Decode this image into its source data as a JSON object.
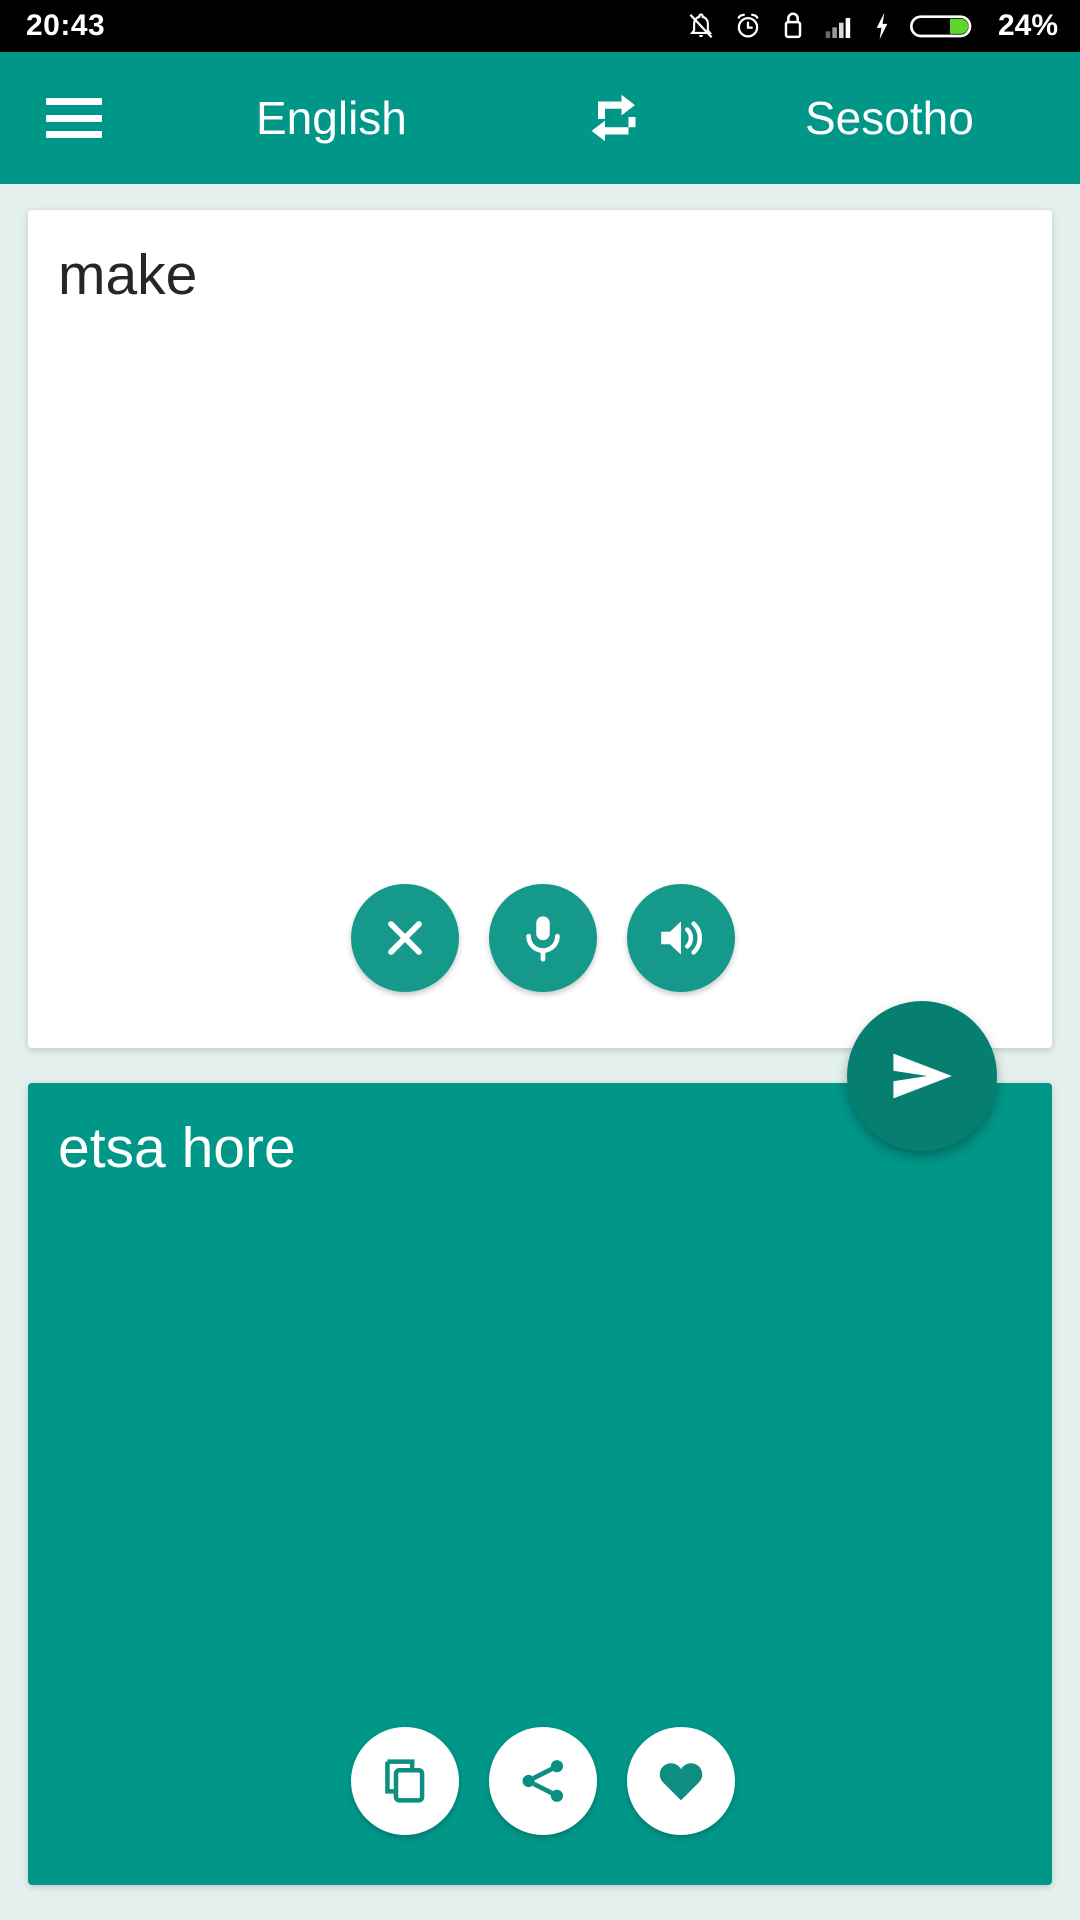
{
  "status_bar": {
    "time": "20:43",
    "battery_percent": "24%",
    "icons": [
      "bell-off-icon",
      "alarm-clock-icon",
      "usb-lock-icon",
      "signal-bars-icon",
      "charging-bolt-icon",
      "battery-icon"
    ]
  },
  "app_bar": {
    "menu_label": "menu-icon",
    "source_language": "English",
    "target_language": "Sesotho",
    "swap_label": "swap-languages-icon",
    "background_color": "#009688"
  },
  "source_card": {
    "text": "make",
    "placeholder": "",
    "actions": [
      {
        "name": "clear-button",
        "icon": "close-icon"
      },
      {
        "name": "voice-input-button",
        "icon": "microphone-icon"
      },
      {
        "name": "speak-source-button",
        "icon": "speaker-icon"
      }
    ],
    "background_color": "#ffffff",
    "button_color": "#14998a"
  },
  "send_button": {
    "name": "translate-send-button",
    "icon": "send-icon",
    "color": "#067f71"
  },
  "target_card": {
    "text": "etsa hore",
    "actions": [
      {
        "name": "copy-button",
        "icon": "copy-icon"
      },
      {
        "name": "share-button",
        "icon": "share-icon"
      },
      {
        "name": "favorite-button",
        "icon": "heart-icon"
      }
    ],
    "background_color": "#009688",
    "icon_color": "#0d8e80"
  },
  "page_background": "#e4f0ee"
}
